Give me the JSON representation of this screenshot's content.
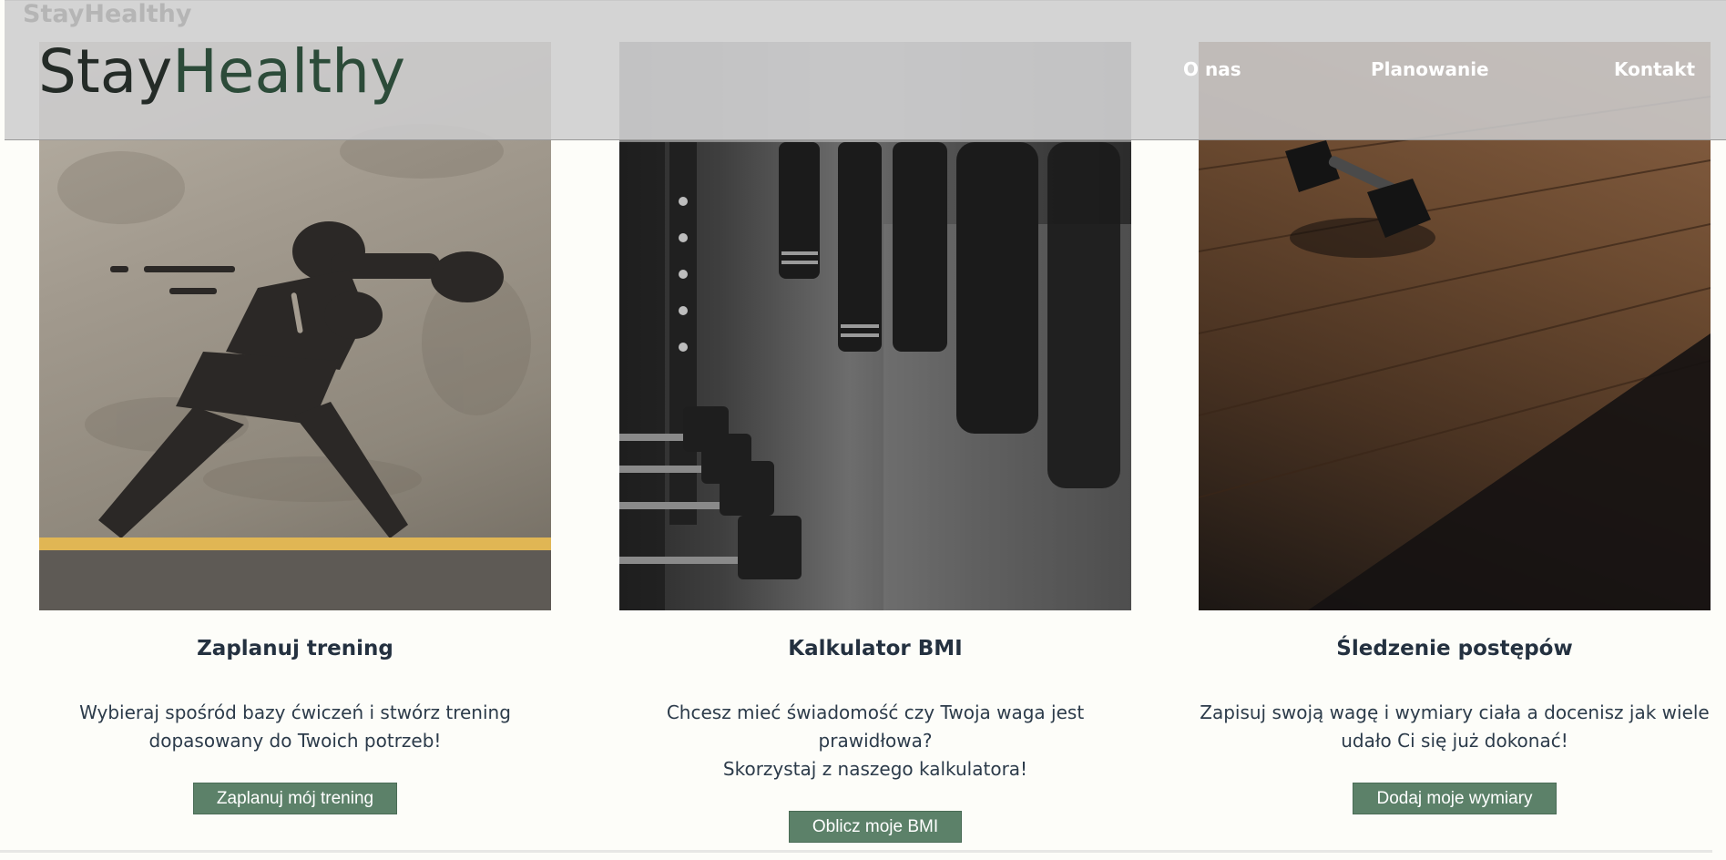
{
  "ghost_title": "StayHealthy",
  "logo": {
    "part1": "Stay",
    "part2": "Healthy"
  },
  "nav": {
    "about": "O nas",
    "planning": "Planowanie",
    "contact": "Kontakt"
  },
  "cards": [
    {
      "title": "Zaplanuj trening",
      "desc_line1": "Wybieraj spośród bazy ćwiczeń i stwórz trening",
      "desc_line2": "dopasowany do Twoich potrzeb!",
      "button": "Zaplanuj mój trening"
    },
    {
      "title": "Kalkulator BMI",
      "desc_line1": "Chcesz mieć świadomość czy Twoja waga jest prawidłowa?",
      "desc_line2": "Skorzystaj z naszego kalkulatora!",
      "button": "Oblicz moje BMI"
    },
    {
      "title": "Śledzenie postępów",
      "desc_line1": "Zapisuj swoją wagę i wymiary ciała a docenisz jak wiele",
      "desc_line2": "udało Ci się już dokonać!",
      "button": "Dodaj moje wymiary"
    }
  ],
  "colors": {
    "accent_button": "#5c8169",
    "logo_accent": "#2c4b39",
    "text_dark": "#243140"
  }
}
